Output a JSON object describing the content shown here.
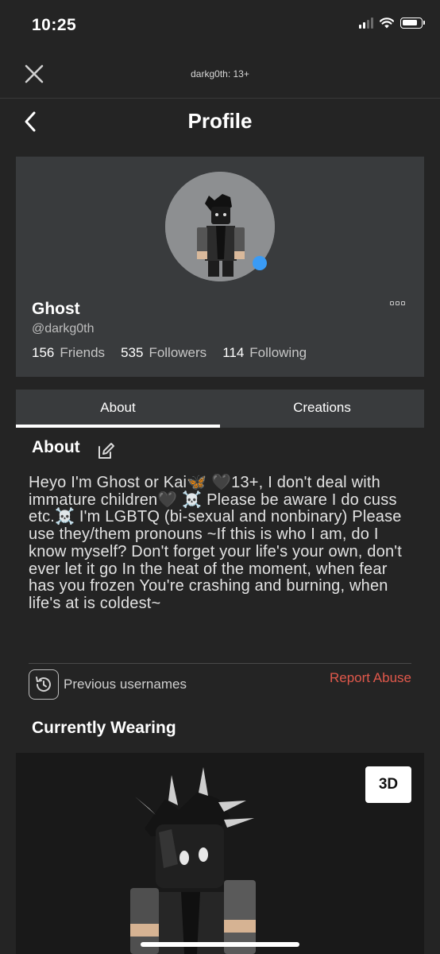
{
  "status_bar": {
    "time": "10:25"
  },
  "topbar": {
    "title": "darkg0th: 13+"
  },
  "header": {
    "title": "Profile"
  },
  "profile": {
    "display_name": "Ghost",
    "username": "@darkg0th",
    "presence_color": "#3a9bf5",
    "stats": [
      {
        "count": "156",
        "label": "Friends"
      },
      {
        "count": "535",
        "label": "Followers"
      },
      {
        "count": "114",
        "label": "Following"
      }
    ]
  },
  "tabs": [
    {
      "label": "About",
      "active": true
    },
    {
      "label": "Creations",
      "active": false
    }
  ],
  "about": {
    "heading": "About",
    "text": "Heyo I'm Ghost or Kai🦋 🖤13+, I don't deal with immature children🖤 ☠️ Please be aware I do cuss etc.☠️ I'm LGBTQ (bi-sexual and nonbinary) Please use they/them pronouns ~If this is who I am, do I know myself? Don't forget your life's your own, don't ever let it go In the heat of the moment, when fear has you frozen You're crashing and burning, when life's at is coldest~",
    "previous_usernames_label": "Previous usernames",
    "report_abuse_label": "Report Abuse",
    "report_color": "#e0584b"
  },
  "wearing": {
    "heading": "Currently Wearing",
    "view_3d_label": "3D"
  }
}
